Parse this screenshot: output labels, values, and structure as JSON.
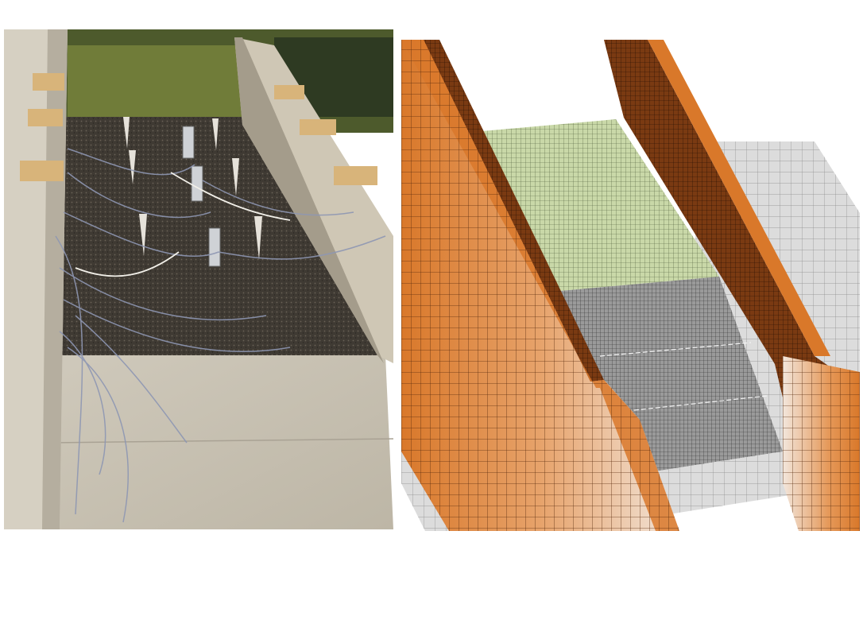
{
  "figure": {
    "panels": [
      {
        "id": "photo",
        "kind": "photograph",
        "subject": "flume-with-instrumented-debris-bed"
      },
      {
        "id": "mesh",
        "kind": "3d-finite-element-mesh",
        "subject": "flume-channel-model"
      }
    ],
    "colors": {
      "background": "#ffffff",
      "wall_orange": "#d9782a",
      "wall_shadow": "#7a3a12",
      "bed_green": "#c9d8a8",
      "bed_grey": "#9a9a9a",
      "ground_grey": "#dcdcdc",
      "concrete": "#c8c2b4",
      "soil": "#3f3a33",
      "cable": "#8e97b3"
    }
  }
}
